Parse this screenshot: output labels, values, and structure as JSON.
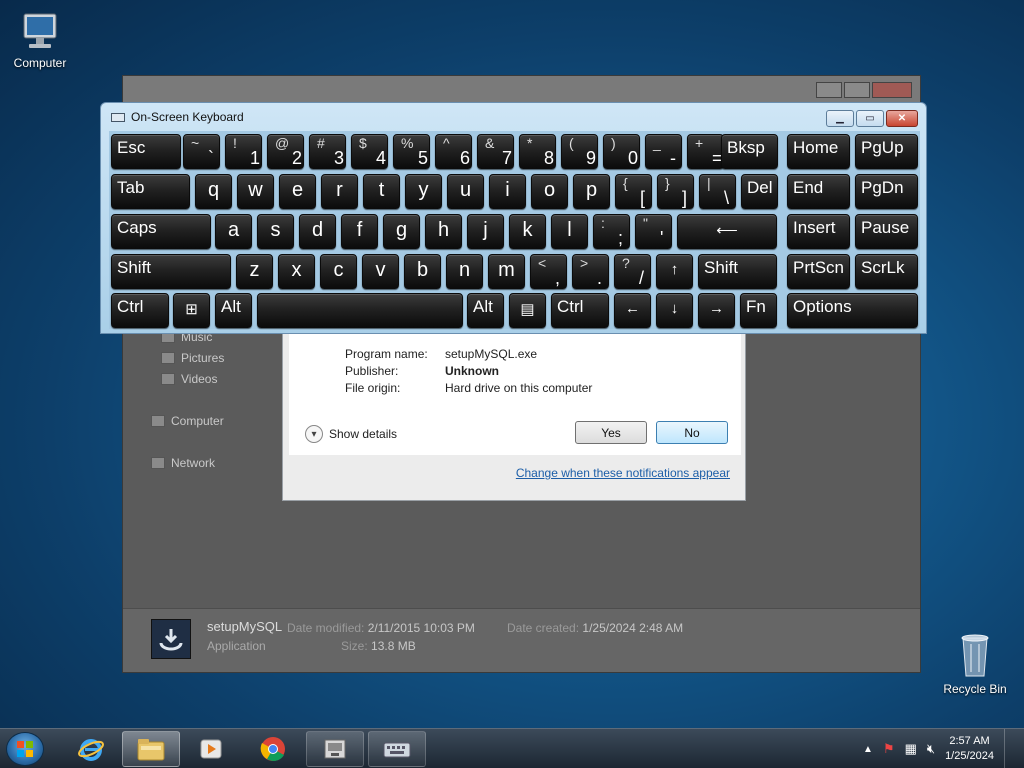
{
  "desktop": {
    "computer_label": "Computer",
    "recycle_label": "Recycle Bin"
  },
  "explorer": {
    "nav": [
      {
        "label": "Music"
      },
      {
        "label": "Pictures"
      },
      {
        "label": "Videos"
      },
      {
        "label": "Computer"
      },
      {
        "label": "Network"
      }
    ],
    "details": {
      "file_name": "setupMySQL",
      "file_type": "Application",
      "date_modified_label": "Date modified:",
      "date_modified": "2/11/2015 10:03 PM",
      "date_created_label": "Date created:",
      "date_created": "1/25/2024 2:48 AM",
      "size_label": "Size:",
      "size": "13.8 MB"
    }
  },
  "uac": {
    "program_name_label": "Program name:",
    "program_name": "setupMySQL.exe",
    "publisher_label": "Publisher:",
    "publisher": "Unknown",
    "file_origin_label": "File origin:",
    "file_origin": "Hard drive on this computer",
    "show_details": "Show details",
    "yes": "Yes",
    "no": "No",
    "change_link": "Change when these notifications appear"
  },
  "osk": {
    "title": "On-Screen Keyboard",
    "rows": [
      [
        {
          "label": "Esc"
        },
        {
          "up": "~",
          "lo": "`"
        },
        {
          "up": "!",
          "lo": "1"
        },
        {
          "up": "@",
          "lo": "2"
        },
        {
          "up": "#",
          "lo": "3"
        },
        {
          "up": "$",
          "lo": "4"
        },
        {
          "up": "%",
          "lo": "5"
        },
        {
          "up": "^",
          "lo": "6"
        },
        {
          "up": "&",
          "lo": "7"
        },
        {
          "up": "*",
          "lo": "8"
        },
        {
          "up": "(",
          "lo": "9"
        },
        {
          "up": ")",
          "lo": "0"
        },
        {
          "up": "_",
          "lo": "-"
        },
        {
          "up": "+",
          "lo": "="
        },
        {
          "label": "Bksp"
        },
        {
          "label": "Home"
        },
        {
          "label": "PgUp"
        }
      ],
      [
        {
          "label": "Tab"
        },
        {
          "label": "q"
        },
        {
          "label": "w"
        },
        {
          "label": "e"
        },
        {
          "label": "r"
        },
        {
          "label": "t"
        },
        {
          "label": "y"
        },
        {
          "label": "u"
        },
        {
          "label": "i"
        },
        {
          "label": "o"
        },
        {
          "label": "p"
        },
        {
          "up": "{",
          "lo": "["
        },
        {
          "up": "}",
          "lo": "]"
        },
        {
          "up": "|",
          "lo": "\\"
        },
        {
          "label": "Del"
        },
        {
          "label": "End"
        },
        {
          "label": "PgDn"
        }
      ],
      [
        {
          "label": "Caps"
        },
        {
          "label": "a"
        },
        {
          "label": "s"
        },
        {
          "label": "d"
        },
        {
          "label": "f"
        },
        {
          "label": "g"
        },
        {
          "label": "h"
        },
        {
          "label": "j"
        },
        {
          "label": "k"
        },
        {
          "label": "l"
        },
        {
          "up": ":",
          "lo": ";"
        },
        {
          "up": "\"",
          "lo": "'"
        },
        {
          "label": "⟵"
        },
        {
          "label": "Insert"
        },
        {
          "label": "Pause"
        }
      ],
      [
        {
          "label": "Shift"
        },
        {
          "label": "z"
        },
        {
          "label": "x"
        },
        {
          "label": "c"
        },
        {
          "label": "v"
        },
        {
          "label": "b"
        },
        {
          "label": "n"
        },
        {
          "label": "m"
        },
        {
          "up": "<",
          "lo": ","
        },
        {
          "up": ">",
          "lo": "."
        },
        {
          "up": "?",
          "lo": "/"
        },
        {
          "label": "↑"
        },
        {
          "label": "Shift"
        },
        {
          "label": "PrtScn"
        },
        {
          "label": "ScrLk"
        }
      ],
      [
        {
          "label": "Ctrl"
        },
        {
          "label": "⊞"
        },
        {
          "label": "Alt"
        },
        {
          "label": ""
        },
        {
          "label": "Alt"
        },
        {
          "label": "▤"
        },
        {
          "label": "Ctrl"
        },
        {
          "label": "←"
        },
        {
          "label": "↓"
        },
        {
          "label": "→"
        },
        {
          "label": "Fn"
        },
        {
          "label": "Options"
        }
      ]
    ]
  },
  "taskbar": {
    "time": "2:57 AM",
    "date": "1/25/2024"
  }
}
